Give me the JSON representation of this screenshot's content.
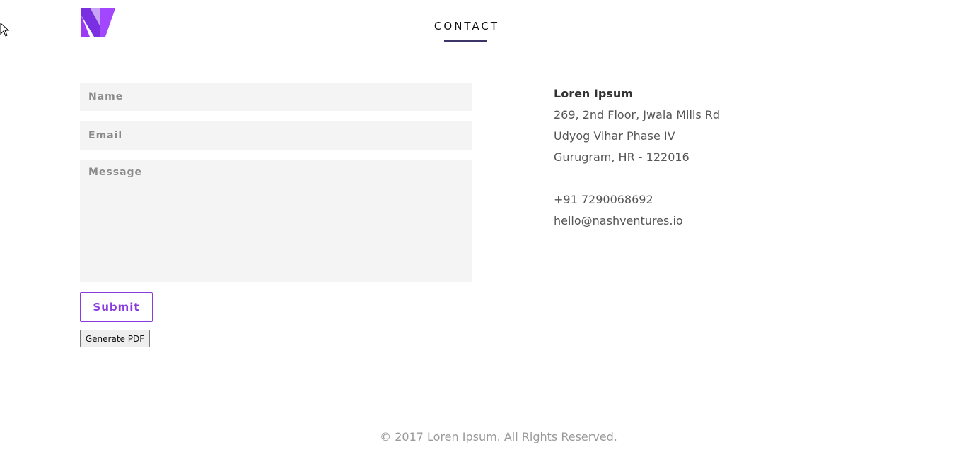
{
  "colors": {
    "brand": "#8a3be0",
    "logo": "#9c3bf5",
    "nav_underline": "#3d3467",
    "field_bg": "#f4f4f4"
  },
  "header": {
    "logo_icon": "n-logo-icon",
    "nav_title": "CONTACT"
  },
  "form": {
    "name_placeholder": "Name",
    "email_placeholder": "Email",
    "message_placeholder": "Message",
    "submit_label": "Submit",
    "pdf_label": "Generate PDF"
  },
  "contact": {
    "company": "Loren Ipsum",
    "address_line1": "269, 2nd Floor, Jwala Mills Rd",
    "address_line2": "Udyog Vihar Phase IV",
    "address_line3": "Gurugram, HR - 122016",
    "phone": "+91 7290068692",
    "email": "hello@nashventures.io"
  },
  "footer": {
    "copyright": "© 2017 Loren Ipsum. All Rights Reserved."
  }
}
